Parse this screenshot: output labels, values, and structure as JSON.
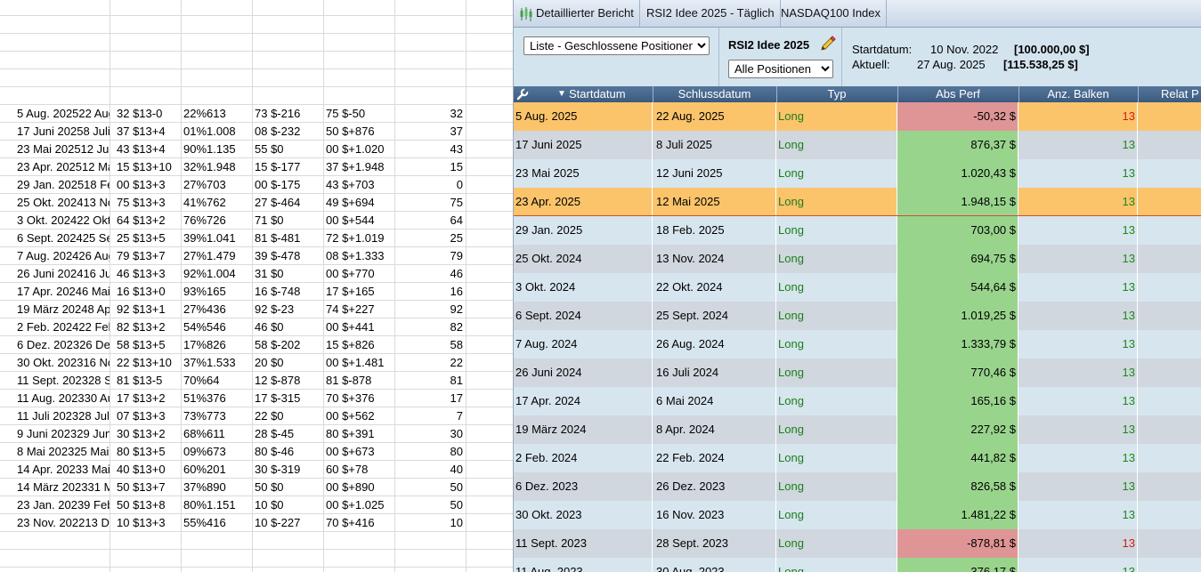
{
  "spreadsheet": {
    "rows": [
      [
        "5 Aug. 202522 Aug",
        "32 $13-0",
        "22%613",
        "73 $-216",
        "75 $-50",
        "32"
      ],
      [
        "17 Juni 20258 Juli",
        "37 $13+4",
        "01%1.008",
        "08 $-232",
        "50 $+876",
        "37"
      ],
      [
        "23 Mai 202512 Jun",
        "43 $13+4",
        "90%1.135",
        "55 $0",
        "00 $+1.020",
        "43"
      ],
      [
        "23 Apr. 202512 Ma",
        "15 $13+10",
        "32%1.948",
        "15 $-177",
        "37 $+1.948",
        "15"
      ],
      [
        "29 Jan. 202518 Fe",
        "00 $13+3",
        "27%703",
        "00 $-175",
        "43 $+703",
        "0"
      ],
      [
        "25 Okt. 202413 No",
        "75 $13+3",
        "41%762",
        "27 $-464",
        "49 $+694",
        "75"
      ],
      [
        "3 Okt. 202422 Okt",
        "64 $13+2",
        "76%726",
        "71 $0",
        "00 $+544",
        "64"
      ],
      [
        "6 Sept. 202425 Se",
        "25 $13+5",
        "39%1.041",
        "81 $-481",
        "72 $+1.019",
        "25"
      ],
      [
        "7 Aug. 202426 Aug",
        "79 $13+7",
        "27%1.479",
        "39 $-478",
        "08 $+1.333",
        "79"
      ],
      [
        "26 Juni 202416 Juli",
        "46 $13+3",
        "92%1.004",
        "31 $0",
        "00 $+770",
        "46"
      ],
      [
        "17 Apr. 20246 Mai",
        "16 $13+0",
        "93%165",
        "16 $-748",
        "17 $+165",
        "16"
      ],
      [
        "19 März 20248 Apr",
        "92 $13+1",
        "27%436",
        "92 $-23",
        "74 $+227",
        "92"
      ],
      [
        "2 Feb. 202422 Feb",
        "82 $13+2",
        "54%546",
        "46 $0",
        "00 $+441",
        "82"
      ],
      [
        "6 Dez. 202326 Dez",
        "58 $13+5",
        "17%826",
        "58 $-202",
        "15 $+826",
        "58"
      ],
      [
        "30 Okt. 202316 No",
        "22 $13+10",
        "37%1.533",
        "20 $0",
        "00 $+1.481",
        "22"
      ],
      [
        "11 Sept. 202328 Se",
        "81 $13-5",
        "70%64",
        "12 $-878",
        "81 $-878",
        "81"
      ],
      [
        "11 Aug. 202330 Au",
        "17 $13+2",
        "51%376",
        "17 $-315",
        "70 $+376",
        "17"
      ],
      [
        "11 Juli 202328 Jul",
        "07 $13+3",
        "73%773",
        "22 $0",
        "00 $+562",
        "7"
      ],
      [
        "9 Juni 202329 Jun",
        "30 $13+2",
        "68%611",
        "28 $-45",
        "80 $+391",
        "30"
      ],
      [
        "8 Mai 202325 Mai",
        "80 $13+5",
        "09%673",
        "80 $-46",
        "00 $+673",
        "80"
      ],
      [
        "14 Apr. 20233 Mai",
        "40 $13+0",
        "60%201",
        "30 $-319",
        "60 $+78",
        "40"
      ],
      [
        "14 März 202331 M",
        "50 $13+7",
        "37%890",
        "50 $0",
        "00 $+890",
        "50"
      ],
      [
        "23 Jan. 20239 Feb",
        "50 $13+8",
        "80%1.151",
        "10 $0",
        "00 $+1.025",
        "50"
      ],
      [
        "23 Nov. 202213 De",
        "10 $13+3",
        "55%416",
        "10 $-227",
        "70 $+416",
        "10"
      ]
    ]
  },
  "report": {
    "tabs": [
      "Detaillierter Bericht",
      "RSI2 Idee 2025 - Täglich",
      "NASDAQ100 Index"
    ],
    "toolbar": {
      "list_select": "Liste - Geschlossene Positionen",
      "strategy_name": "RSI2 Idee 2025",
      "positions_select": "Alle Positionen",
      "start_label": "Startdatum:",
      "start_date": "10 Nov. 2022",
      "start_value": "[100.000,00 $]",
      "current_label": "Aktuell:",
      "current_date": "27 Aug. 2025",
      "current_value": "[115.538,25 $]"
    },
    "columns": [
      "Startdatum",
      "Schlussdatum",
      "Typ",
      "Abs Perf",
      "Anz. Balken",
      "Relat P"
    ],
    "colors": {
      "positive": "#99d48d",
      "negative": "#df9595",
      "highlight": "#fbc46b",
      "header": "#3b5a80"
    },
    "rows": [
      {
        "start": "5 Aug. 2025",
        "end": "22 Aug. 2025",
        "type": "Long",
        "perf": "-50,32 $",
        "bars": "13",
        "neg": true,
        "hl": true
      },
      {
        "start": "17 Juni 2025",
        "end": "8 Juli 2025",
        "type": "Long",
        "perf": "876,37 $",
        "bars": "13",
        "neg": false,
        "hl": false
      },
      {
        "start": "23 Mai 2025",
        "end": "12 Juni 2025",
        "type": "Long",
        "perf": "1.020,43 $",
        "bars": "13",
        "neg": false,
        "hl": false
      },
      {
        "start": "23 Apr. 2025",
        "end": "12 Mai 2025",
        "type": "Long",
        "perf": "1.948,15 $",
        "bars": "13",
        "neg": false,
        "hl": true
      },
      {
        "start": "29 Jan. 2025",
        "end": "18 Feb. 2025",
        "type": "Long",
        "perf": "703,00 $",
        "bars": "13",
        "neg": false,
        "hl": false
      },
      {
        "start": "25 Okt. 2024",
        "end": "13 Nov. 2024",
        "type": "Long",
        "perf": "694,75 $",
        "bars": "13",
        "neg": false,
        "hl": false
      },
      {
        "start": "3 Okt. 2024",
        "end": "22 Okt. 2024",
        "type": "Long",
        "perf": "544,64 $",
        "bars": "13",
        "neg": false,
        "hl": false
      },
      {
        "start": "6 Sept. 2024",
        "end": "25 Sept. 2024",
        "type": "Long",
        "perf": "1.019,25 $",
        "bars": "13",
        "neg": false,
        "hl": false
      },
      {
        "start": "7 Aug. 2024",
        "end": "26 Aug. 2024",
        "type": "Long",
        "perf": "1.333,79 $",
        "bars": "13",
        "neg": false,
        "hl": false
      },
      {
        "start": "26 Juni 2024",
        "end": "16 Juli 2024",
        "type": "Long",
        "perf": "770,46 $",
        "bars": "13",
        "neg": false,
        "hl": false
      },
      {
        "start": "17 Apr. 2024",
        "end": "6 Mai 2024",
        "type": "Long",
        "perf": "165,16 $",
        "bars": "13",
        "neg": false,
        "hl": false
      },
      {
        "start": "19 März 2024",
        "end": "8 Apr. 2024",
        "type": "Long",
        "perf": "227,92 $",
        "bars": "13",
        "neg": false,
        "hl": false
      },
      {
        "start": "2 Feb. 2024",
        "end": "22 Feb. 2024",
        "type": "Long",
        "perf": "441,82 $",
        "bars": "13",
        "neg": false,
        "hl": false
      },
      {
        "start": "6 Dez. 2023",
        "end": "26 Dez. 2023",
        "type": "Long",
        "perf": "826,58 $",
        "bars": "13",
        "neg": false,
        "hl": false
      },
      {
        "start": "30 Okt. 2023",
        "end": "16 Nov. 2023",
        "type": "Long",
        "perf": "1.481,22 $",
        "bars": "13",
        "neg": false,
        "hl": false
      },
      {
        "start": "11 Sept. 2023",
        "end": "28 Sept. 2023",
        "type": "Long",
        "perf": "-878,81 $",
        "bars": "13",
        "neg": true,
        "hl": false
      },
      {
        "start": "11 Aug. 2023",
        "end": "30 Aug. 2023",
        "type": "Long",
        "perf": "376,17 $",
        "bars": "13",
        "neg": false,
        "hl": false
      }
    ]
  }
}
